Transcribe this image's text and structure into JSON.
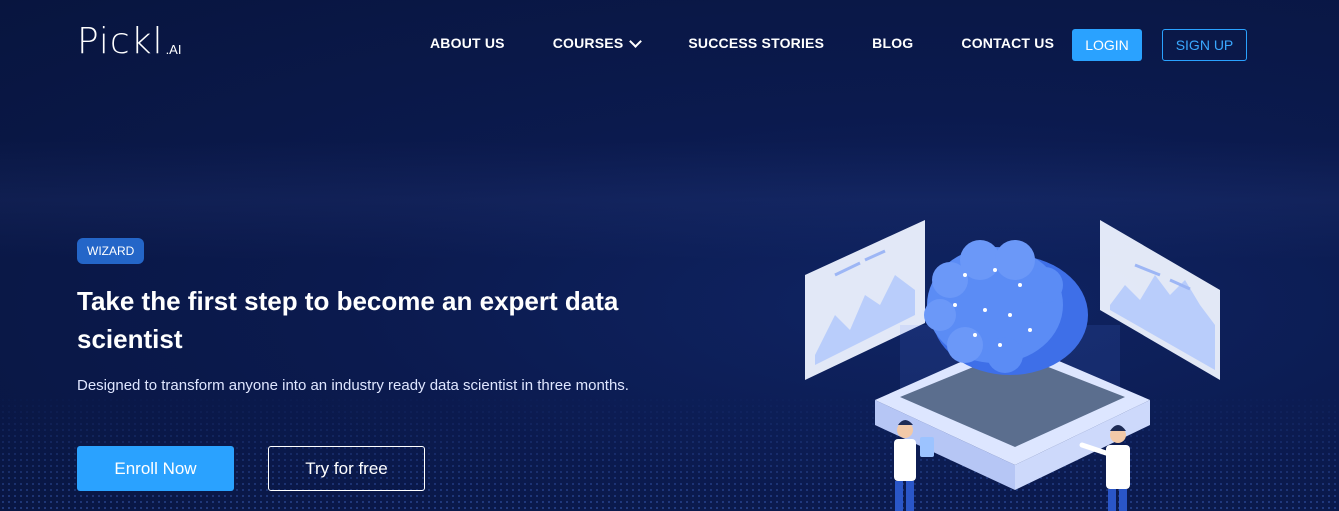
{
  "brand": {
    "name": "Pickl",
    "suffix": ".AI"
  },
  "nav": {
    "items": [
      "ABOUT US",
      "COURSES",
      "SUCCESS STORIES",
      "BLOG",
      "CONTACT US"
    ],
    "login": "LOGIN",
    "signup": "SIGN UP"
  },
  "hero": {
    "badge": "WIZARD",
    "headline": "Take the first step to become an expert data scientist",
    "subline": "Designed to transform anyone into an industry ready data scientist in three months.",
    "enroll": "Enroll Now",
    "try": "Try for free"
  },
  "icons": {
    "courses_dropdown": "chevron-down-icon",
    "illustration": "ai-brain-illustration"
  },
  "colors": {
    "background": "#0b1a4e",
    "accent": "#2aa2ff",
    "badge": "#2466c8"
  }
}
